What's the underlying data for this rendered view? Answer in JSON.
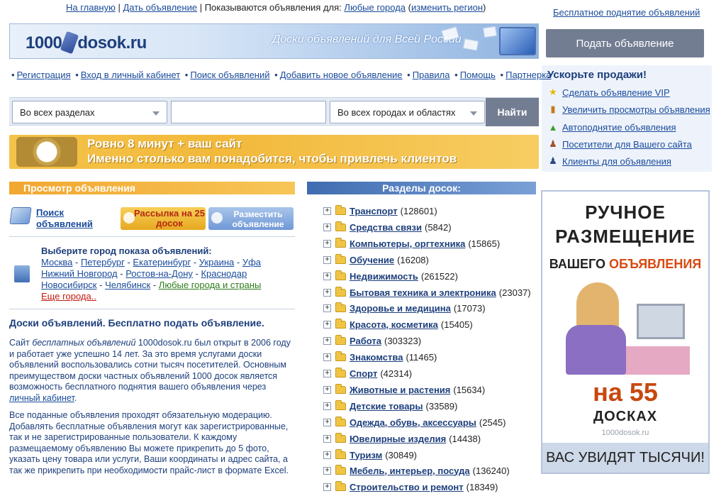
{
  "topnav": {
    "home": "На главную",
    "post_ad": "Дать объявление",
    "showing_text": "Показываются объявления для:",
    "any_cities": "Любые города",
    "change_region": "изменить регион"
  },
  "banner": {
    "logo_left": "1000",
    "logo_right": "dosok.ru",
    "tagline": "Доски объявлений  для Всей России"
  },
  "right": {
    "free_raise": "Бесплатное поднятие объявлений",
    "post_ad_button": "Подать объявление",
    "boost_title": "Ускорьте продажи!",
    "boost_items": [
      {
        "label": "Сделать объявление VIP",
        "icon": "star-icon"
      },
      {
        "label": "Увеличить просмотры объявления",
        "icon": "chart-icon"
      },
      {
        "label": "Автоподнятие объявления",
        "icon": "up-arrow-icon"
      },
      {
        "label": "Посетители для Вашего сайта",
        "icon": "visitor-icon"
      },
      {
        "label": "Клиенты для объявления",
        "icon": "client-icon"
      }
    ]
  },
  "navbar": [
    "Регистрация",
    "Вход в личный кабинет",
    "Поиск объявлений",
    "Добавить новое объявление",
    "Правила",
    "Помощь",
    "Партнерка"
  ],
  "search": {
    "section_select": "Во всех разделах",
    "query_value": "",
    "region_select": "Во всех городах и областях",
    "button": "Найти"
  },
  "promo": {
    "line1": "Ровно 8 минут + ваш сайт",
    "line2": "Именно столько вам понадобится, чтобы привлечь клиентов"
  },
  "view": {
    "header": "Просмотр объявления",
    "search_ads": "Поиск объявлений",
    "mailing_button": "Рассылка на 25 досок",
    "place_button": "Разместить объявление"
  },
  "cities": {
    "title": "Выберите город показа объявлений:",
    "line1": [
      "Москва",
      "Петербург",
      "Екатеринбург",
      "Украина",
      "Уфа"
    ],
    "line2": [
      "Нижний Новгород",
      "Ростов-на-Дону",
      "Краснодар"
    ],
    "line3": [
      "Новосибирск",
      "Челябинск"
    ],
    "any": "Любые города и страны",
    "more": "Еще города.."
  },
  "about": {
    "title": "Доски объявлений. Бесплатно подать объявление.",
    "p1_prefix": "Сайт ",
    "p1_italic": "бесплатных объявлений",
    "p1_rest": " 1000dosok.ru был открыт в 2006 году и работает уже успешно 14 лет. За это время услугами доски объявлений воспользовались сотни тысяч посетителей. Основным преимуществом доски частных объявлений 1000 досок является возможность бесплатного поднятия вашего объявления через ",
    "p1_link": "личный кабинет",
    "p1_end": ".",
    "p2": "Все поданные объявления проходят обязательную модерацию. Добавлять бесплатные объявления могут как зарегистрированные, так и не зарегистрированные пользователи. К каждому размещаемому объявлению Вы можете прикрепить до 5 фото, указать цену товара или услуги, Ваши координаты и адрес сайта, а так же прикрепить при необходимости прайс-лист в формате Excel."
  },
  "boards": {
    "header": "Разделы досок:",
    "categories": [
      {
        "name": "Транспорт",
        "count": "(128601)"
      },
      {
        "name": "Средства связи",
        "count": "(5842)"
      },
      {
        "name": "Компьютеры, оргтехника",
        "count": "(15865)"
      },
      {
        "name": "Обучение",
        "count": "(16208)"
      },
      {
        "name": "Недвижимость",
        "count": "(261522)"
      },
      {
        "name": "Бытовая техника и электроника",
        "count": "(23037)"
      },
      {
        "name": "Здоровье и медицина",
        "count": "(17073)"
      },
      {
        "name": "Красота, косметика",
        "count": "(15405)"
      },
      {
        "name": "Работа",
        "count": "(303323)"
      },
      {
        "name": "Знакомства",
        "count": "(11465)"
      },
      {
        "name": "Спорт",
        "count": "(42314)"
      },
      {
        "name": "Животные и растения",
        "count": "(15634)"
      },
      {
        "name": "Детские товары",
        "count": "(33589)"
      },
      {
        "name": "Одежда, обувь, аксессуары",
        "count": "(2545)"
      },
      {
        "name": "Ювелирные изделия",
        "count": "(14438)"
      },
      {
        "name": "Туризм",
        "count": "(30849)"
      },
      {
        "name": "Мебель, интерьер, посуда",
        "count": "(136240)"
      },
      {
        "name": "Строительство и ремонт",
        "count": "(18349)"
      }
    ]
  },
  "ad": {
    "line1": "РУЧНОЕ",
    "line2": "РАЗМЕЩЕНИЕ",
    "line3_a": "ВАШЕГО ",
    "line3_b": "ОБЪЯВЛЕНИЯ",
    "line4": "на 55",
    "line5": "ДОСКАХ",
    "line6": "1000dosok.ru",
    "line7": "ВАС УВИДЯТ ТЫСЯЧИ!"
  }
}
